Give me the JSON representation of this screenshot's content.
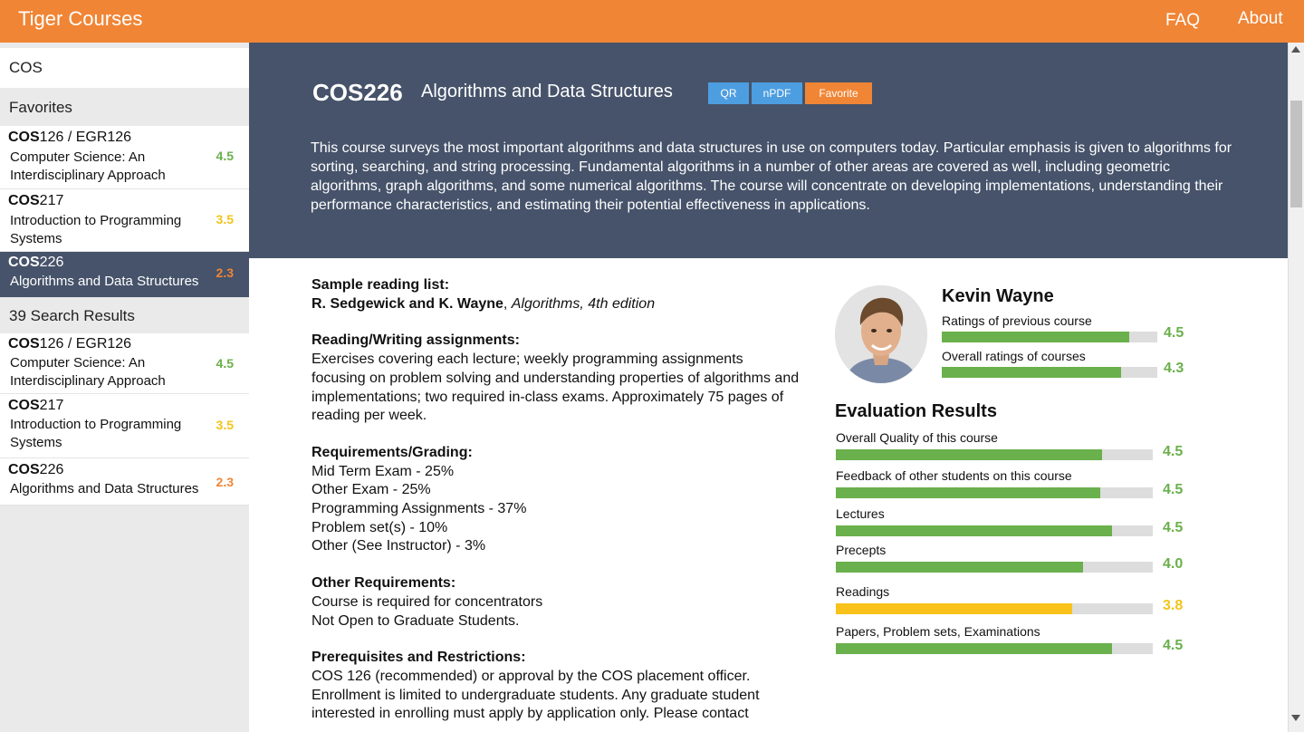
{
  "app": {
    "title": "Tiger Courses",
    "nav": {
      "faq": "FAQ",
      "about": "About"
    }
  },
  "sidebar": {
    "search_value": "COS",
    "favorites_header": "Favorites",
    "favorites": [
      {
        "code_bold": "COS",
        "code_rest": "126 / EGR126",
        "title": "Computer Science: An Interdisciplinary Approach",
        "rating": "4.5"
      },
      {
        "code_bold": "COS",
        "code_rest": "217",
        "title": "Introduction to Programming Systems",
        "rating": "3.5"
      },
      {
        "code_bold": "COS",
        "code_rest": "226",
        "title": "Algorithms and Data Structures",
        "rating": "2.3"
      }
    ],
    "results_header": "39 Search Results",
    "results": [
      {
        "code_bold": "COS",
        "code_rest": "126 / EGR126",
        "title": "Computer Science: An Interdisciplinary Approach",
        "rating": "4.5"
      },
      {
        "code_bold": "COS",
        "code_rest": "217",
        "title": "Introduction to Programming Systems",
        "rating": "3.5"
      },
      {
        "code_bold": "COS",
        "code_rest": "226",
        "title": "Algorithms and Data Structures",
        "rating": "2.3"
      }
    ]
  },
  "course": {
    "code": "COS226",
    "title": "Algorithms and Data Structures",
    "buttons": {
      "qr": "QR",
      "npdf": "nPDF",
      "favorite": "Favorite"
    },
    "description": "This course surveys the most important algorithms and data structures in use on computers today. Particular emphasis is given to algorithms for sorting, searching, and string processing. Fundamental algorithms in a number of other areas are covered as well, including geometric algorithms, graph algorithms, and some numerical algorithms. The course will concentrate on developing implementations, understanding their performance characteristics, and estimating their potential effectiveness in applications."
  },
  "info": {
    "reading_list_header": "Sample reading list:",
    "reading_author": "R. Sedgewick and K. Wayne",
    "reading_sep": ", ",
    "reading_book": "Algorithms, 4th edition",
    "assignments_header": "Reading/Writing assignments:",
    "assignments_text": "Exercises covering each lecture; weekly programming assignments focusing on problem solving and understanding properties of algorithms and implementations; two required in-class exams. Approximately 75 pages of reading per week.",
    "grading_header": "Requirements/Grading:",
    "grading": [
      "Mid Term Exam - 25%",
      "Other Exam - 25%",
      "Programming Assignments - 37%",
      "Problem set(s) - 10%",
      "Other (See Instructor) - 3%"
    ],
    "other_req_header": "Other Requirements:",
    "other_req": [
      "Course is required for concentrators",
      "Not Open to Graduate Students."
    ],
    "prereq_header": "Prerequisites and Restrictions:",
    "prereq_text": "COS 126 (recommended) or approval by the COS placement officer. Enrollment is limited to undergraduate students. Any graduate student interested in enrolling must apply by application only. Please contact"
  },
  "instructor": {
    "name": "Kevin Wayne",
    "ratings": [
      {
        "label": "Ratings of previous course",
        "value": "4.5",
        "fraction": 0.87
      },
      {
        "label": "Overall ratings of courses",
        "value": "4.3",
        "fraction": 0.83
      }
    ]
  },
  "evaluation": {
    "title": "Evaluation Results",
    "items": [
      {
        "label": "Overall Quality of this course",
        "value": "4.5",
        "fraction": 0.84,
        "color": "#6ab04c"
      },
      {
        "label": "Feedback of other students on this course",
        "value": "4.5",
        "fraction": 0.835,
        "color": "#6ab04c"
      },
      {
        "label": "Lectures",
        "value": "4.5",
        "fraction": 0.87,
        "color": "#6ab04c"
      },
      {
        "label": "Precepts",
        "value": "4.0",
        "fraction": 0.78,
        "color": "#6ab04c"
      },
      {
        "label": "Readings",
        "value": "3.8",
        "fraction": 0.745,
        "color": "#f8c21a"
      },
      {
        "label": "Papers, Problem sets, Examinations",
        "value": "4.5",
        "fraction": 0.87,
        "color": "#6ab04c"
      }
    ]
  }
}
